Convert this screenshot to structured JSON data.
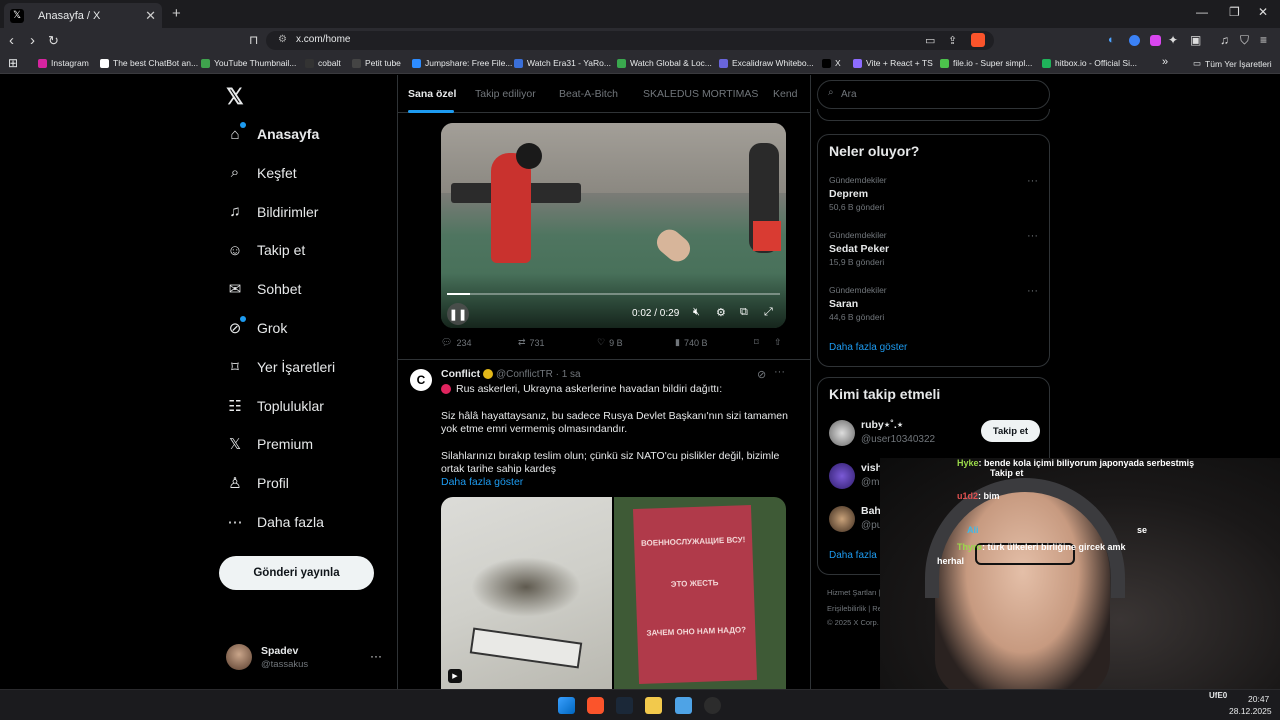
{
  "browser": {
    "tab_title": "Anasayfa / X",
    "url": "x.com/home",
    "bookmarks": [
      {
        "label": "Instagram",
        "color": "#d6249f"
      },
      {
        "label": "The best ChatBot an...",
        "color": "#ffffff"
      },
      {
        "label": "YouTube Thumbnail...",
        "color": "#3fa34d"
      },
      {
        "label": "cobalt",
        "color": "#333333"
      },
      {
        "label": "Petit tube",
        "color": "#444444"
      },
      {
        "label": "Jumpshare: Free File...",
        "color": "#2d8cff"
      },
      {
        "label": "Watch Era31 - YaRo...",
        "color": "#3a6fd8"
      },
      {
        "label": "Watch Global & Loc...",
        "color": "#3aa84e"
      },
      {
        "label": "Excalidraw Whitebo...",
        "color": "#6965db"
      },
      {
        "label": "X",
        "color": "#000000"
      },
      {
        "label": "Vite + React + TS",
        "color": "#8d6cff"
      },
      {
        "label": "file.io - Super simpl...",
        "color": "#4cc24c"
      },
      {
        "label": "hitbox.io - Official Si...",
        "color": "#1fb35a"
      }
    ],
    "all_bookmarks": "Tüm Yer İşaretleri"
  },
  "sidebar": {
    "items": [
      {
        "label": "Anasayfa",
        "icon": "home-icon"
      },
      {
        "label": "Keşfet",
        "icon": "search-icon"
      },
      {
        "label": "Bildirimler",
        "icon": "bell-icon"
      },
      {
        "label": "Takip et",
        "icon": "follow-icon"
      },
      {
        "label": "Sohbet",
        "icon": "mail-icon"
      },
      {
        "label": "Grok",
        "icon": "grok-icon"
      },
      {
        "label": "Yer İşaretleri",
        "icon": "bookmark-icon"
      },
      {
        "label": "Topluluklar",
        "icon": "communities-icon"
      },
      {
        "label": "Premium",
        "icon": "x-icon"
      },
      {
        "label": "Profil",
        "icon": "profile-icon"
      },
      {
        "label": "Daha fazla",
        "icon": "more-icon"
      }
    ],
    "post_button": "Gönderi yayınla",
    "account": {
      "name": "Spadev",
      "handle": "@tassakus"
    }
  },
  "feed": {
    "tabs": [
      "Sana özel",
      "Takip ediliyor",
      "Beat-A-Bitch",
      "SKALEDUS MORTIMAS",
      "Kend"
    ],
    "video": {
      "time": "0:02 / 0:29",
      "progress": 0.07
    },
    "stats1": {
      "replies": "234",
      "reposts": "731",
      "likes": "9 B",
      "views": "740 B"
    },
    "tweet2": {
      "name": "Conflict",
      "handle": "@ConflictTR · 1 sa",
      "line1": "Rus askerleri, Ukrayna askerlerine havadan bildiri dağıttı:",
      "para2a": "Siz hâlâ hayattaysanız, bu sadece Rusya Devlet Başkanı'nın sizi tamamen",
      "para2b": "yok etme emri vermemiş olmasındandır.",
      "para3a": "Silahlarınızı bırakıp teslim olun; çünkü siz NATO'cu pislikler değil, bizimle",
      "para3b": "ortak tarihe sahip kardeş",
      "show_more": "Daha fazla göster",
      "poster_title": "ВОЕННОСЛУЖАЩИЕ ВСУ!",
      "poster_sub": "ЭТО ЖЕСТЬ",
      "poster_q": "ЗАЧЕМ ОНО НАМ НАДО?"
    }
  },
  "right": {
    "search_placeholder": "Ara",
    "trends_title": "Neler oluyor?",
    "trends": [
      {
        "context": "Gündemdekiler",
        "name": "Deprem",
        "count": "50,6 B gönderi"
      },
      {
        "context": "Gündemdekiler",
        "name": "Sedat Peker",
        "count": "15,9 B gönderi"
      },
      {
        "context": "Gündemdekiler",
        "name": "Saran",
        "count": "44,6 B gönderi"
      }
    ],
    "trends_more": "Daha fazla göster",
    "who_title": "Kimi takip etmeli",
    "who": [
      {
        "name": "ruby⋆˚.⋆",
        "handle": "@user10340322",
        "button": "Takip et"
      },
      {
        "name": "vishnu",
        "handle": "@mmeandthede"
      },
      {
        "name": "Bahadır Telci",
        "handle": "@purpleblxi"
      }
    ],
    "who_more": "Daha fazla göster",
    "footer1": "Hizmet Şartları  |  Gizlilik Polit",
    "footer2": "Erişilebilirlik  |  Reklam bilgi",
    "footer3": "© 2025 X Corp."
  },
  "overlay_chat": [
    {
      "user": "Hyke",
      "msg": ": bende kola içimi biliyorum japonyada serbestmiş",
      "color": "#9ad94a"
    },
    {
      "user": "Takip et",
      "msg": "",
      "color": "#ffffff"
    },
    {
      "user": "u1d2",
      "msg": ": bim",
      "color": "#e05050"
    },
    {
      "user": "Ali",
      "msg": "",
      "color": "#3fb9e8"
    },
    {
      "user": "",
      "msg": "se",
      "color": "#ffffff"
    },
    {
      "user": "Thyro",
      "msg": ": türk ülkeleri birliğine gircek amk",
      "color": "#9ad94a"
    },
    {
      "user": "herhal",
      "msg": "",
      "color": "#ffffff"
    }
  ],
  "taskbar": {
    "time": "20:47",
    "date": "28.12.2025",
    "tray": "UfE0"
  }
}
